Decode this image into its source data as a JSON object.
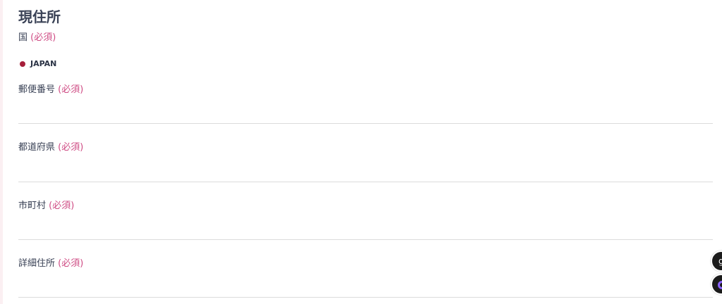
{
  "section": {
    "title": "現住所"
  },
  "fields": [
    {
      "label": "国",
      "required": "(必須)"
    },
    {
      "label": "郵便番号",
      "required": "(必須)"
    },
    {
      "label": "都道府県",
      "required": "(必須)"
    },
    {
      "label": "市町村",
      "required": "(必須)"
    },
    {
      "label": "詳細住所",
      "required": "(必須)"
    }
  ],
  "country": {
    "selected": "JAPAN"
  },
  "floating": {
    "top_button_glyph": "g",
    "top_button_icon": "chat-icon",
    "bottom_button_icon": "assistant-ring-icon"
  },
  "colors": {
    "required": "#cf4c84",
    "radio": "#a61f3a",
    "text": "#3a4256"
  }
}
